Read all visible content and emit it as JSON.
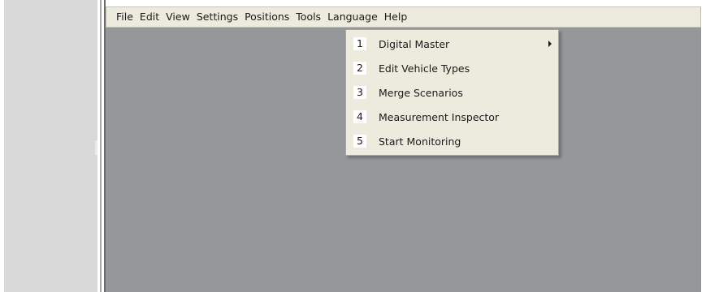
{
  "menubar": {
    "items": [
      "File",
      "Edit",
      "View",
      "Settings",
      "Positions",
      "Tools",
      "Language",
      "Help"
    ]
  },
  "tools_menu": {
    "items": [
      {
        "number": "1",
        "label": "Digital Master",
        "has_submenu": true,
        "icon": "chevron-right-icon"
      },
      {
        "number": "2",
        "label": "Edit Vehicle Types",
        "has_submenu": false
      },
      {
        "number": "3",
        "label": "Merge Scenarios",
        "has_submenu": false
      },
      {
        "number": "4",
        "label": "Measurement Inspector",
        "has_submenu": false
      },
      {
        "number": "5",
        "label": "Start Monitoring",
        "has_submenu": false
      }
    ]
  },
  "colors": {
    "menubar_bg": "#ecebdd",
    "workspace_bg": "#959898",
    "left_panel_bg": "#d8d9d8"
  }
}
